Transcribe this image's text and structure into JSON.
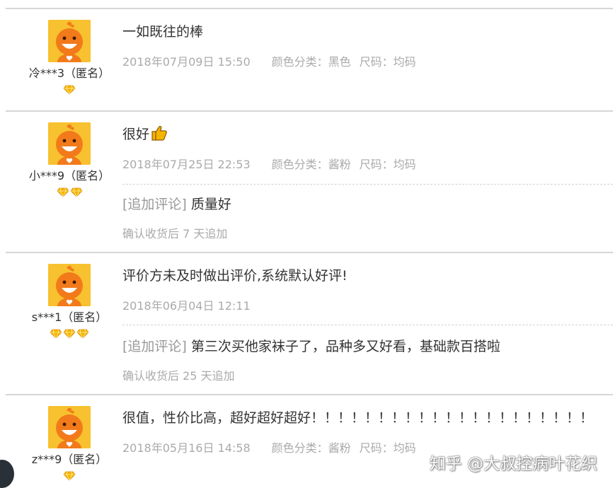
{
  "reviews": [
    {
      "username": "冷***3（匿名）",
      "badge_count": 1,
      "content": "一如既往的棒",
      "time": "2018年07月09日 15:50",
      "sku": [
        "颜色分类：黑色",
        "尺码：均码"
      ]
    },
    {
      "username": "小***9（匿名）",
      "badge_count": 2,
      "content": "很好",
      "has_thumb_icon": true,
      "time": "2018年07月25日 22:53",
      "sku": [
        "颜色分类：酱粉",
        "尺码：均码"
      ],
      "append_tag": "[追加评论]",
      "append_text": " 质量好",
      "append_note": "确认收货后 7 天追加"
    },
    {
      "username": "s***1（匿名）",
      "badge_count": 3,
      "content": "评价方未及时做出评价,系统默认好评!",
      "time": "2018年06月04日 12:11",
      "append_tag": "[追加评论]",
      "append_text": " 第三次买他家袜子了，品种多又好看，基础款百搭啦",
      "append_note": "确认收货后 25 天追加"
    },
    {
      "username": "z***9（匿名）",
      "badge_count": 1,
      "content": "很值，性价比高，超好超好超好！！！！！！！！！！！！！！！！！！！！！",
      "time": "2018年05月16日 14:58",
      "sku": [
        "颜色分类：酱粉",
        "尺码：均码"
      ]
    }
  ],
  "watermark": "知乎 @大叔控病叶花织",
  "colors": {
    "avatar_bg": "#f7c12f",
    "mascot_orange": "#f27a1a",
    "badge_gold": "#f5b400",
    "meta_gray": "#aaaaaa",
    "append_tag_gray": "#999999"
  },
  "icons": {
    "avatar": "orange-mascot-avatar",
    "badge": "gold-diamond-icon",
    "thumb": "thumbs-up-icon"
  }
}
